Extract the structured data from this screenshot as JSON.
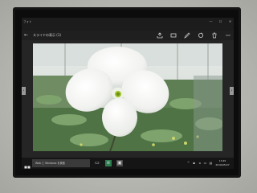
{
  "window": {
    "app_title": "フォト",
    "controls": {
      "minimize": "—",
      "maximize": "☐",
      "close": "✕"
    }
  },
  "command_bar": {
    "filename": "スライドの表示 (1)",
    "back_icon": "back-arrow-icon",
    "icons": [
      "share-icon",
      "slideshow-icon",
      "edit-icon",
      "rotate-icon",
      "delete-icon",
      "more-icon"
    ]
  },
  "viewer": {
    "prev_label": "‹",
    "next_label": "›",
    "image_subject": "white-orchid-photo"
  },
  "taskbar": {
    "search_placeholder": "Web と Windows を検索",
    "time": "13:45",
    "date": "2016/05/27",
    "colors": {
      "taskbar": "#151515",
      "search": "#3a3a3a"
    }
  }
}
